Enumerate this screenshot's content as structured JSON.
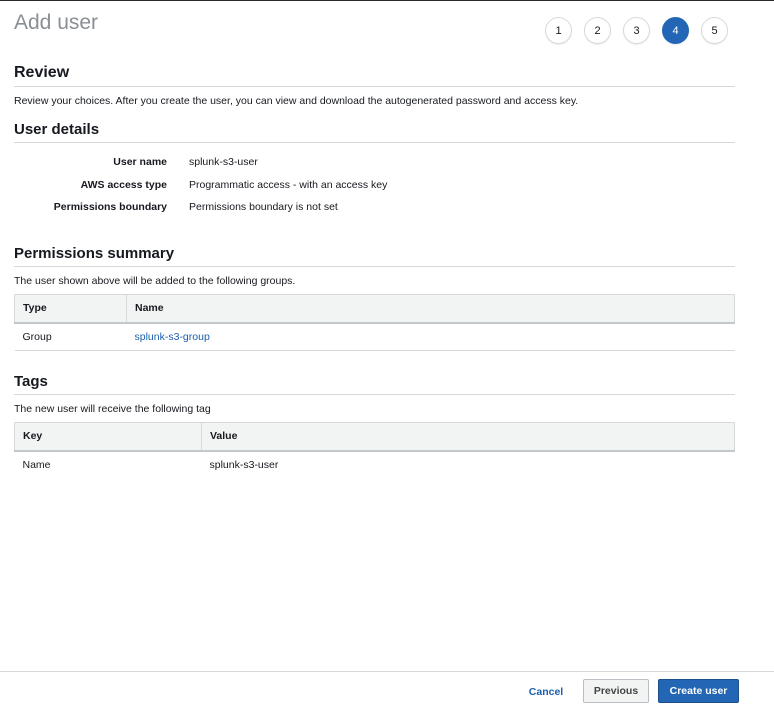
{
  "header": {
    "title": "Add user",
    "steps": [
      {
        "label": "1",
        "active": false
      },
      {
        "label": "2",
        "active": false
      },
      {
        "label": "3",
        "active": false
      },
      {
        "label": "4",
        "active": true
      },
      {
        "label": "5",
        "active": false
      }
    ]
  },
  "review": {
    "title": "Review",
    "description": "Review your choices. After you create the user, you can view and download the autogenerated password and access key."
  },
  "user_details": {
    "title": "User details",
    "rows": [
      {
        "label": "User name",
        "value": "splunk-s3-user"
      },
      {
        "label": "AWS access type",
        "value": "Programmatic access - with an access key"
      },
      {
        "label": "Permissions boundary",
        "value": "Permissions boundary is not set"
      }
    ]
  },
  "permissions": {
    "title": "Permissions summary",
    "description": "The user shown above will be added to the following groups.",
    "columns": [
      "Type",
      "Name"
    ],
    "rows": [
      {
        "type": "Group",
        "name": "splunk-s3-group"
      }
    ]
  },
  "tags": {
    "title": "Tags",
    "description": "The new user will receive the following tag",
    "columns": [
      "Key",
      "Value"
    ],
    "rows": [
      {
        "key": "Name",
        "value": "splunk-s3-user"
      }
    ]
  },
  "footer": {
    "cancel": "Cancel",
    "previous": "Previous",
    "create": "Create user"
  },
  "colors": {
    "accent": "#2366b5",
    "link": "#1b5fad",
    "table_header_bg": "#f2f3f3"
  }
}
